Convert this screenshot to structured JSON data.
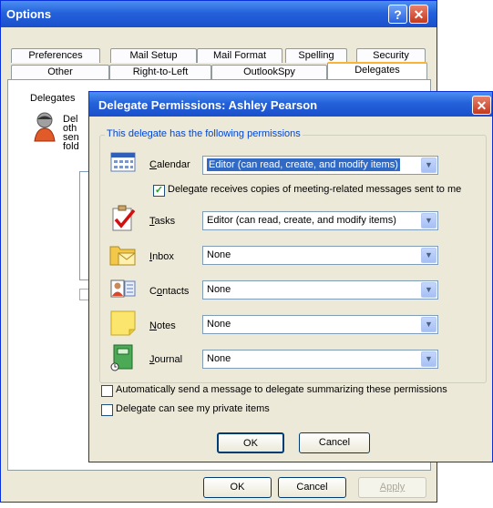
{
  "options": {
    "title": "Options",
    "tabs_row1": [
      "Preferences",
      "Mail Setup",
      "Mail Format",
      "Spelling",
      "Security"
    ],
    "tabs_row2": [
      "Other",
      "Right-to-Left",
      "OutlookSpy",
      "Delegates"
    ],
    "delegates_label": "Delegates",
    "delegates_desc_fragments": [
      "Del",
      "oth",
      "sen",
      "fold"
    ],
    "buttons": {
      "ok": "OK",
      "cancel": "Cancel",
      "apply": "Apply"
    }
  },
  "dialog": {
    "title": "Delegate Permissions: Ashley Pearson",
    "group_label": "This delegate has the following permissions",
    "rows": [
      {
        "label": "Calendar",
        "value": "Editor (can read, create, and modify items)",
        "icon": "calendar-icon"
      },
      {
        "label": "Tasks",
        "value": "Editor (can read, create, and modify items)",
        "icon": "tasks-icon"
      },
      {
        "label": "Inbox",
        "value": "None",
        "icon": "inbox-icon"
      },
      {
        "label": "Contacts",
        "value": "None",
        "icon": "contacts-icon"
      },
      {
        "label": "Notes",
        "value": "None",
        "icon": "notes-icon"
      },
      {
        "label": "Journal",
        "value": "None",
        "icon": "journal-icon"
      }
    ],
    "meeting_copies": "Delegate receives copies of meeting-related messages sent to me",
    "auto_send": "Automatically send a message to delegate summarizing these permissions",
    "private_items": "Delegate can see my private items",
    "buttons": {
      "ok": "OK",
      "cancel": "Cancel"
    }
  },
  "colors": {
    "titlebar": "#2462da",
    "selection": "#316ac5",
    "dialog_bg": "#ece9d8"
  }
}
